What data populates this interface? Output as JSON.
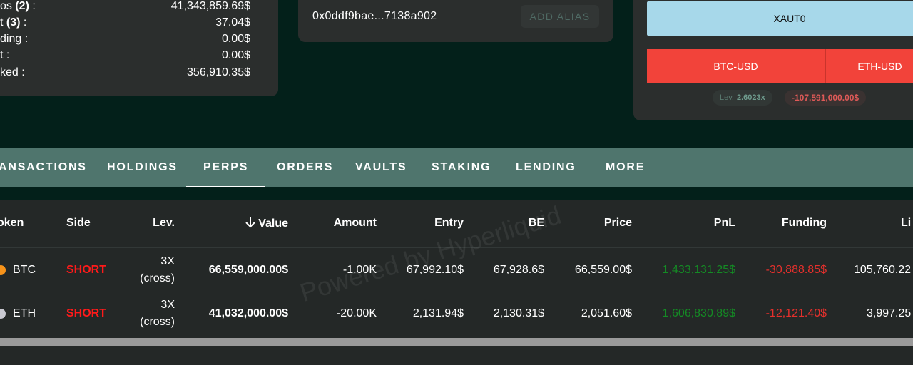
{
  "summary": {
    "rows": [
      {
        "label_prefix": "os ",
        "label_bold": "(2)",
        "label_suffix": " :",
        "value": "41,343,859.69$"
      },
      {
        "label_prefix": "t ",
        "label_bold": "(3)",
        "label_suffix": " :",
        "value": "37.04$"
      },
      {
        "label_prefix": "ding :",
        "label_bold": "",
        "label_suffix": "",
        "value": "0.00$"
      },
      {
        "label_prefix": "t :",
        "label_bold": "",
        "label_suffix": "",
        "value": "0.00$"
      },
      {
        "label_prefix": "ked :",
        "label_bold": "",
        "label_suffix": "",
        "value": "356,910.35$"
      }
    ]
  },
  "address": {
    "text": "0x0ddf9bae...7138a902",
    "alias_label": "ADD ALIAS"
  },
  "market": {
    "xaut_label": "XAUT0",
    "pairs": [
      "BTC-USD",
      "ETH-USD"
    ],
    "lev_label": "Lev.",
    "lev_value": "2.6023x",
    "pnl_value": "-107,591,000.00$"
  },
  "tabs": [
    "ANSACTIONS",
    "HOLDINGS",
    "PERPS",
    "ORDERS",
    "VAULTS",
    "STAKING",
    "LENDING",
    "MORE"
  ],
  "active_tab": "PERPS",
  "table": {
    "headers": {
      "token": "oken",
      "side": "Side",
      "lev": "Lev.",
      "value": "Value",
      "amount": "Amount",
      "entry": "Entry",
      "be": "BE",
      "price": "Price",
      "pnl": "PnL",
      "funding": "Funding",
      "liq": "Li"
    },
    "rows": [
      {
        "token": "BTC",
        "side": "SHORT",
        "lev_top": "3X",
        "lev_bottom": "(cross)",
        "value": "66,559,000.00$",
        "amount": "-1.00K",
        "entry": "67,992.10$",
        "be": "67,928.6$",
        "price": "66,559.00$",
        "pnl": "1,433,131.25$",
        "funding": "-30,888.85$",
        "liq": "105,760.22"
      },
      {
        "token": "ETH",
        "side": "SHORT",
        "lev_top": "3X",
        "lev_bottom": "(cross)",
        "value": "41,032,000.00$",
        "amount": "-20.00K",
        "entry": "2,131.94$",
        "be": "2,130.31$",
        "price": "2,051.60$",
        "pnl": "1,606,830.89$",
        "funding": "-12,121.40$",
        "liq": "3,997.25"
      }
    ]
  },
  "watermark": "Powered by Hyperliquid",
  "colors": {
    "background": "#03201a",
    "panel": "#2b2e2d",
    "tabs_bar": "#4f756d",
    "short": "#ff1a1a",
    "pnl_positive": "#148a24",
    "funding_negative": "#e5302c",
    "xaut_button": "#a7d8ea",
    "pair_button": "#f2433a",
    "btc_icon": "#f7931a",
    "eth_icon": "#c9c9d1"
  }
}
